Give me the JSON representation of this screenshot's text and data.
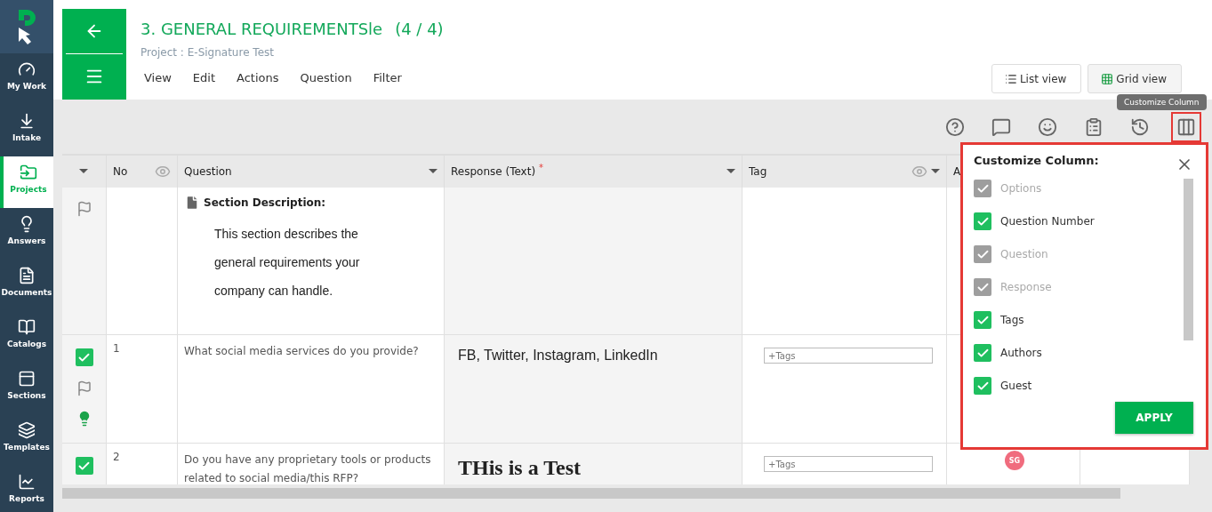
{
  "sidebar": {
    "items": [
      {
        "label": "My Work",
        "selected": false
      },
      {
        "label": "Intake",
        "selected": false
      },
      {
        "label": "Projects",
        "selected": true
      },
      {
        "label": "Answers",
        "selected": false
      },
      {
        "label": "Documents",
        "selected": false
      },
      {
        "label": "Catalogs",
        "selected": false
      },
      {
        "label": "Sections",
        "selected": false
      },
      {
        "label": "Templates",
        "selected": false
      },
      {
        "label": "Reports",
        "selected": false
      }
    ]
  },
  "header": {
    "title": "3. GENERAL REQUIREMENTSle",
    "count": "(4 / 4)",
    "project": "Project : E-Signature Test",
    "menu": [
      "View",
      "Edit",
      "Actions",
      "Question",
      "Filter"
    ],
    "views": [
      "List view",
      "Grid view"
    ]
  },
  "tooltip": "Customize Column",
  "toolbar": [
    {
      "highlighted": false
    },
    {
      "highlighted": false
    },
    {
      "highlighted": false
    },
    {
      "highlighted": false
    },
    {
      "highlighted": false
    },
    {
      "highlighted": true
    }
  ],
  "table": {
    "columns": [
      {
        "label": "No",
        "eye": true,
        "caret": false
      },
      {
        "label": "Question",
        "eye": false,
        "caret": true
      },
      {
        "label": "Response (Text)",
        "required_mark": "*",
        "eye": false,
        "caret": true
      },
      {
        "label": "Tag",
        "eye": true,
        "caret": true
      },
      {
        "label": "A"
      }
    ],
    "rows": [
      {
        "kind": "section",
        "heading": "Section Description:",
        "lines": [
          "This section describes the",
          "general requirements your",
          "company can handle."
        ]
      },
      {
        "kind": "question",
        "checked": true,
        "answered": true,
        "no": "1",
        "question": "What social media services do you provide?",
        "response": {
          "kind": "plain",
          "text": "FB, Twitter, Instagram, LinkedIn"
        },
        "tag_placeholder": "+Tags"
      },
      {
        "kind": "question",
        "checked": true,
        "answered": false,
        "no": "2",
        "question": "Do you have any proprietary tools or products related to social media/this RFP?",
        "response": {
          "kind": "heading",
          "text": "THis is a Test"
        },
        "tag_placeholder": "+Tags",
        "author": {
          "initials": "SG",
          "color": "#f06c7e"
        }
      }
    ]
  },
  "customize": {
    "title": "Customize Column:",
    "options": [
      {
        "label": "Options",
        "checked": true,
        "disabled": true
      },
      {
        "label": "Question Number",
        "checked": true,
        "disabled": false
      },
      {
        "label": "Question",
        "checked": true,
        "disabled": true
      },
      {
        "label": "Response",
        "checked": true,
        "disabled": true
      },
      {
        "label": "Tags",
        "checked": true,
        "disabled": false
      },
      {
        "label": "Authors",
        "checked": true,
        "disabled": false
      },
      {
        "label": "Guest",
        "checked": true,
        "disabled": false
      }
    ],
    "apply": "APPLY"
  }
}
